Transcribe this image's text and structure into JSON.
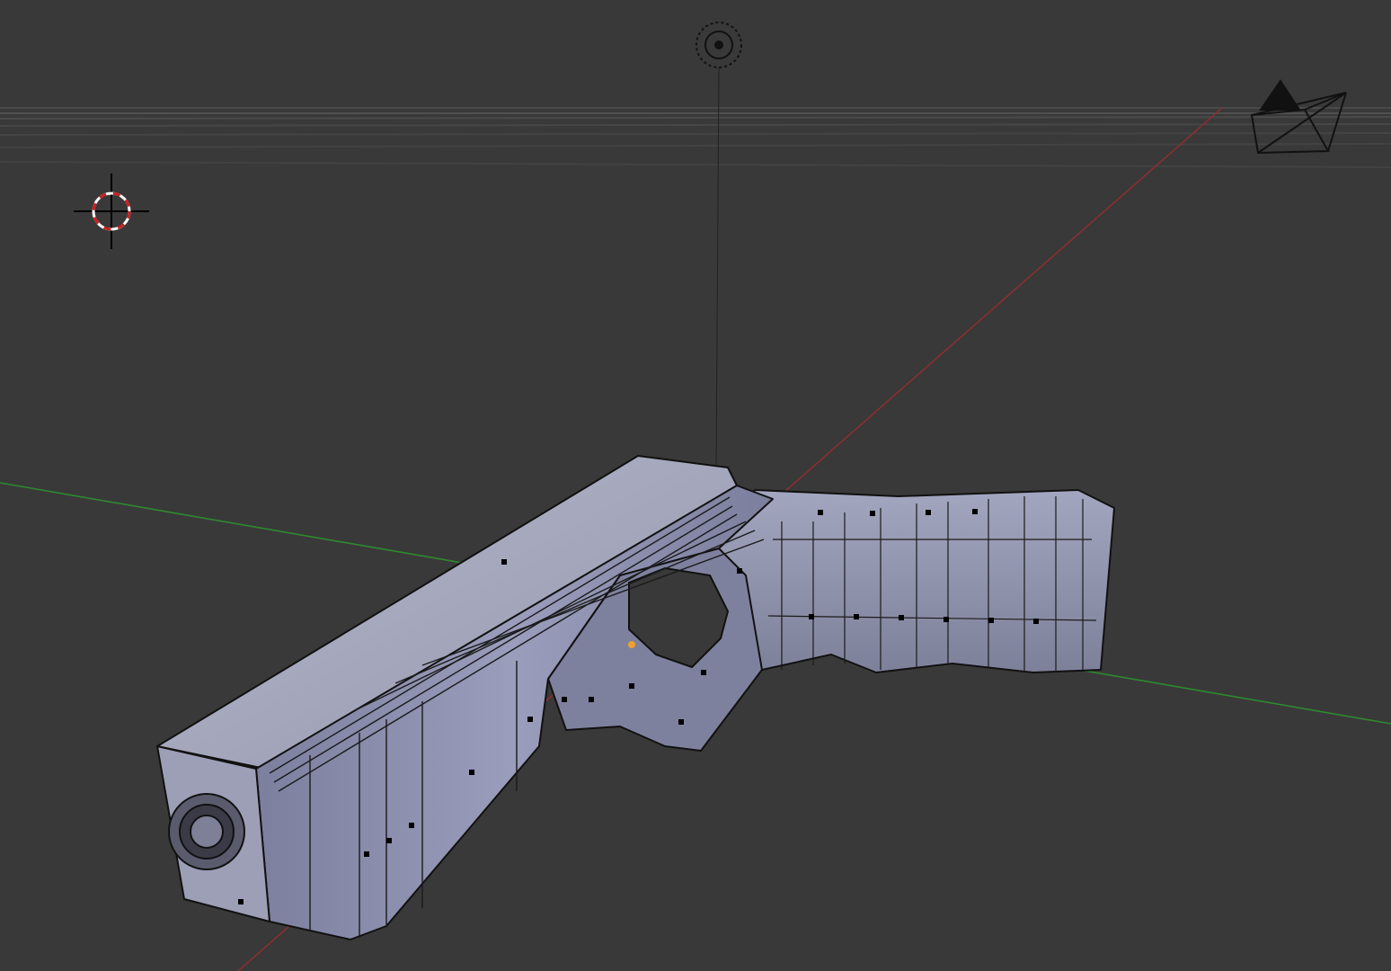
{
  "app": {
    "name": "3D Viewport",
    "view": "perspective",
    "background_color": "#393939"
  },
  "scene": {
    "objects": [
      {
        "name": "pistol-mesh",
        "type": "mesh",
        "mode": "edit",
        "color": "#8f92b2"
      },
      {
        "name": "camera",
        "type": "camera",
        "color": "#000000"
      },
      {
        "name": "lamp",
        "type": "lamp",
        "color": "#000000"
      }
    ],
    "cursor": {
      "name": "3d-cursor",
      "colors": [
        "#cc1f1f",
        "#ffffff"
      ]
    },
    "axes": {
      "x": {
        "color": "#8a2f2f"
      },
      "y": {
        "color": "#2f8a2f"
      }
    },
    "selected_vertex_color": "#f0a030",
    "vertex_color": "#000000"
  }
}
